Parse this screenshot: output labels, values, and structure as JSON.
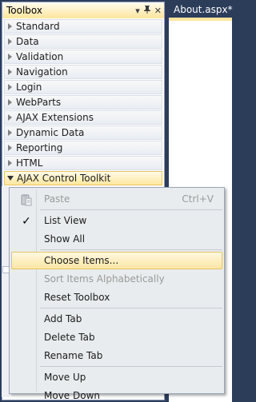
{
  "toolbox": {
    "title": "Toolbox",
    "pin_glyph": "▾",
    "autohide_glyph": "⊥",
    "close_glyph": "✕",
    "tabs": [
      {
        "label": "Standard"
      },
      {
        "label": "Data"
      },
      {
        "label": "Validation"
      },
      {
        "label": "Navigation"
      },
      {
        "label": "Login"
      },
      {
        "label": "WebParts"
      },
      {
        "label": "AJAX Extensions"
      },
      {
        "label": "Dynamic Data"
      },
      {
        "label": "Reporting"
      },
      {
        "label": "HTML"
      },
      {
        "label": "AJAX Control Toolkit"
      }
    ]
  },
  "document": {
    "tab_label": "About.aspx*"
  },
  "context_menu": {
    "paste": {
      "label": "Paste",
      "shortcut": "Ctrl+V"
    },
    "list_view": {
      "label": "List View",
      "checked": true
    },
    "show_all": {
      "label": "Show All"
    },
    "choose_items": {
      "label": "Choose Items..."
    },
    "sort_alpha": {
      "label": "Sort Items Alphabetically"
    },
    "reset_toolbox": {
      "label": "Reset Toolbox"
    },
    "add_tab": {
      "label": "Add Tab"
    },
    "delete_tab": {
      "label": "Delete Tab"
    },
    "rename_tab": {
      "label": "Rename Tab"
    },
    "move_up": {
      "label": "Move Up"
    },
    "move_down": {
      "label": "Move Down"
    }
  },
  "colors": {
    "frame": "#2c3d5a",
    "highlight": "#fde6a3",
    "menu_bg": "#e9ecee"
  }
}
